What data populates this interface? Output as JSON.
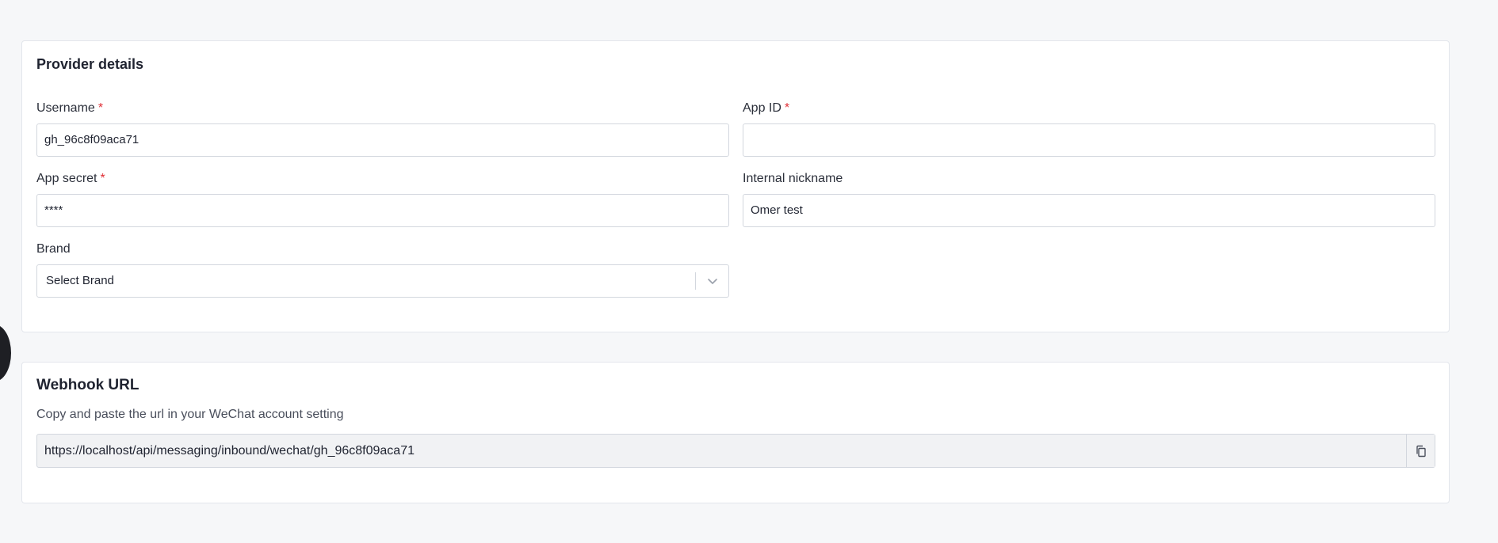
{
  "provider_details": {
    "title": "Provider details",
    "username": {
      "label": "Username",
      "required_mark": "*",
      "value": "gh_96c8f09aca71"
    },
    "app_id": {
      "label": "App ID",
      "required_mark": "*",
      "value": ""
    },
    "app_secret": {
      "label": "App secret",
      "required_mark": "*",
      "value": "****"
    },
    "internal_nickname": {
      "label": "Internal nickname",
      "value": "Omer test"
    },
    "brand": {
      "label": "Brand",
      "placeholder": "Select Brand"
    }
  },
  "webhook": {
    "title": "Webhook URL",
    "description": "Copy and paste the url in your WeChat account setting",
    "url": "https://localhost/api/messaging/inbound/wechat/gh_96c8f09aca71",
    "copy_icon": "copy-icon"
  },
  "colors": {
    "required": "#e02f36",
    "card_border": "#e3e6ec",
    "background": "#f6f7f9"
  }
}
